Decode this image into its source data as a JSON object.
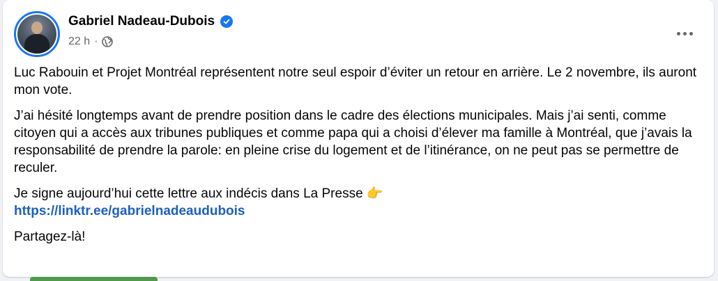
{
  "post": {
    "author": "Gabriel Nadeau-Dubois",
    "time": "22 h",
    "separator": "·",
    "icons": {
      "verified": "verified-badge-icon",
      "audience": "globe-icon",
      "more": "more-options-icon"
    },
    "colors": {
      "accent": "#1877f2",
      "link": "#1d5fbf",
      "meta": "#65676b"
    },
    "paragraphs": {
      "p1": "Luc Rabouin et Projet Montréal représentent notre seul espoir d’éviter un retour en arrière. Le 2 novembre, ils auront mon vote.",
      "p2": "J’ai hésité longtemps avant de prendre position dans le cadre des élections municipales. Mais j’ai senti, comme citoyen qui a accès aux tribunes publiques et comme papa qui a choisi d’élever ma famille à Montréal, que j’avais la responsabilité de prendre la parole: en pleine crise du logement et de l’itinérance, on ne peut pas se permettre de reculer.",
      "p3": "Je signe aujourd’hui cette lettre aux indécis dans La Presse",
      "p3_emoji": "👉",
      "link": "https://linktr.ee/gabrielnadeaudubois",
      "p4": "Partagez-là!"
    }
  }
}
